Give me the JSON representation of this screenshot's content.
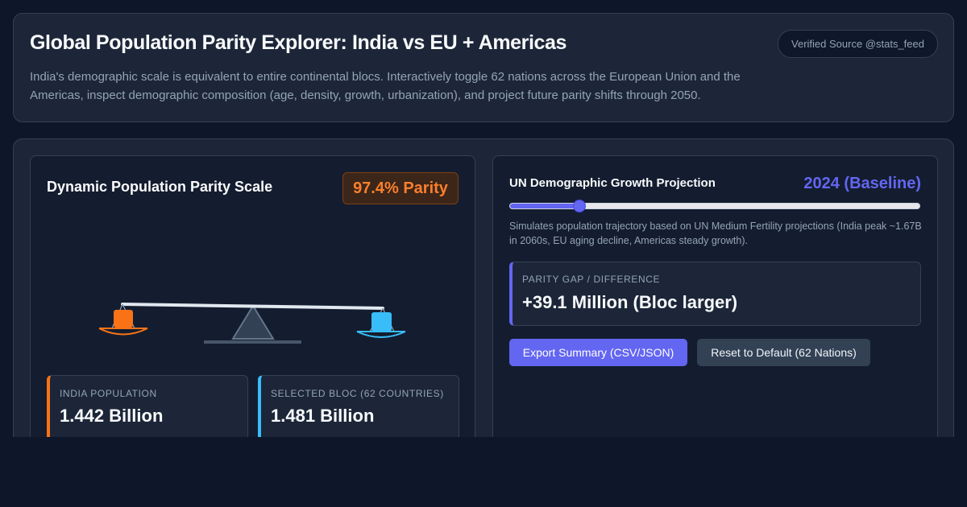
{
  "header": {
    "title": "Global Population Parity Explorer: India vs EU + Americas",
    "source_badge": "Verified Source @stats_feed",
    "description": "India's demographic scale is equivalent to entire continental blocs. Interactively toggle 62 nations across the European Union and the Americas, inspect demographic composition (age, density, growth, urbanization), and project future parity shifts through 2050."
  },
  "scale_panel": {
    "title": "Dynamic Population Parity Scale",
    "parity_badge": "97.4% Parity",
    "india_color": "#f97316",
    "bloc_color": "#38bdf8",
    "india": {
      "label": "India Population",
      "value": "1.442 Billion"
    },
    "bloc": {
      "label": "Selected Bloc (62 Countries)",
      "value": "1.481 Billion"
    }
  },
  "projection_panel": {
    "title": "UN Demographic Growth Projection",
    "year_label": "2024 (Baseline)",
    "slider": {
      "level": 0.17
    },
    "note": "Simulates population trajectory based on UN Medium Fertility projections (India peak ~1.67B in 2060s, EU aging decline, Americas steady growth).",
    "gap": {
      "label": "Parity Gap / Difference",
      "value": "+39.1 Million (Bloc larger)"
    },
    "accent_color": "#6366f1"
  },
  "actions": {
    "export_label": "Export Summary (CSV/JSON)",
    "reset_label": "Reset to Default (62 Nations)"
  }
}
